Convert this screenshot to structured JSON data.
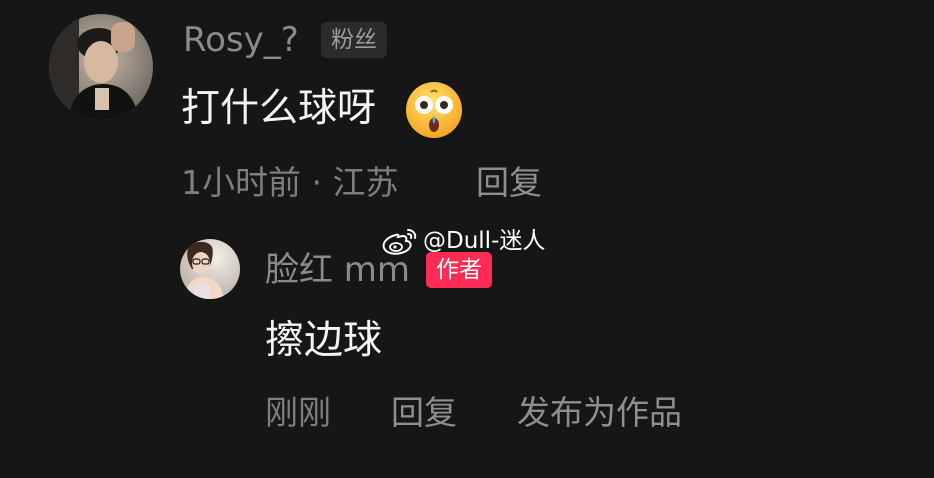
{
  "comment": {
    "username": "Rosy_?",
    "badge": "粉丝",
    "text": "打什么球呀",
    "emoji": "astonished-face-emoji",
    "meta": "1小时前 · 江苏",
    "reply_label": "回复"
  },
  "reply": {
    "username": "脸红 mm",
    "badge": "作者",
    "text": "擦边球",
    "time": "刚刚",
    "reply_label": "回复",
    "publish_label": "发布为作品"
  },
  "watermark": {
    "icon": "weibo-icon",
    "text": "@Dull-迷人"
  },
  "colors": {
    "background": "#161616",
    "author_badge": "#fe2c55",
    "muted_text": "#8a8a8f"
  }
}
